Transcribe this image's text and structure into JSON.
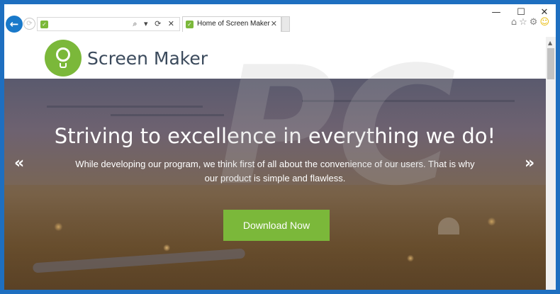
{
  "window": {
    "controls": {
      "minimize": "—",
      "maximize": "☐",
      "close": "✕"
    }
  },
  "toolbar": {
    "back_glyph": "←",
    "forward_glyph": "⟳",
    "address_icons": "⌕ ▾ ⟳ ✕",
    "favicon_glyph": "✓"
  },
  "tab": {
    "title": "Home of Screen Maker",
    "close_glyph": "✕"
  },
  "tools": {
    "home": "⌂",
    "favorites": "☆",
    "settings": "⚙",
    "feedback": "☺"
  },
  "site": {
    "logo_text": "Screen Maker"
  },
  "hero": {
    "title": "Striving to excellence in everything we do!",
    "subtitle": "While developing our program, we think first of all about the convenience of our users. That is why our product is simple and flawless.",
    "prev_glyph": "«",
    "next_glyph": "»",
    "cta_label": "Download Now"
  },
  "colors": {
    "accent_green": "#7bb83a",
    "frame_blue": "#1e6fc0",
    "back_button_blue": "#1979ca"
  }
}
